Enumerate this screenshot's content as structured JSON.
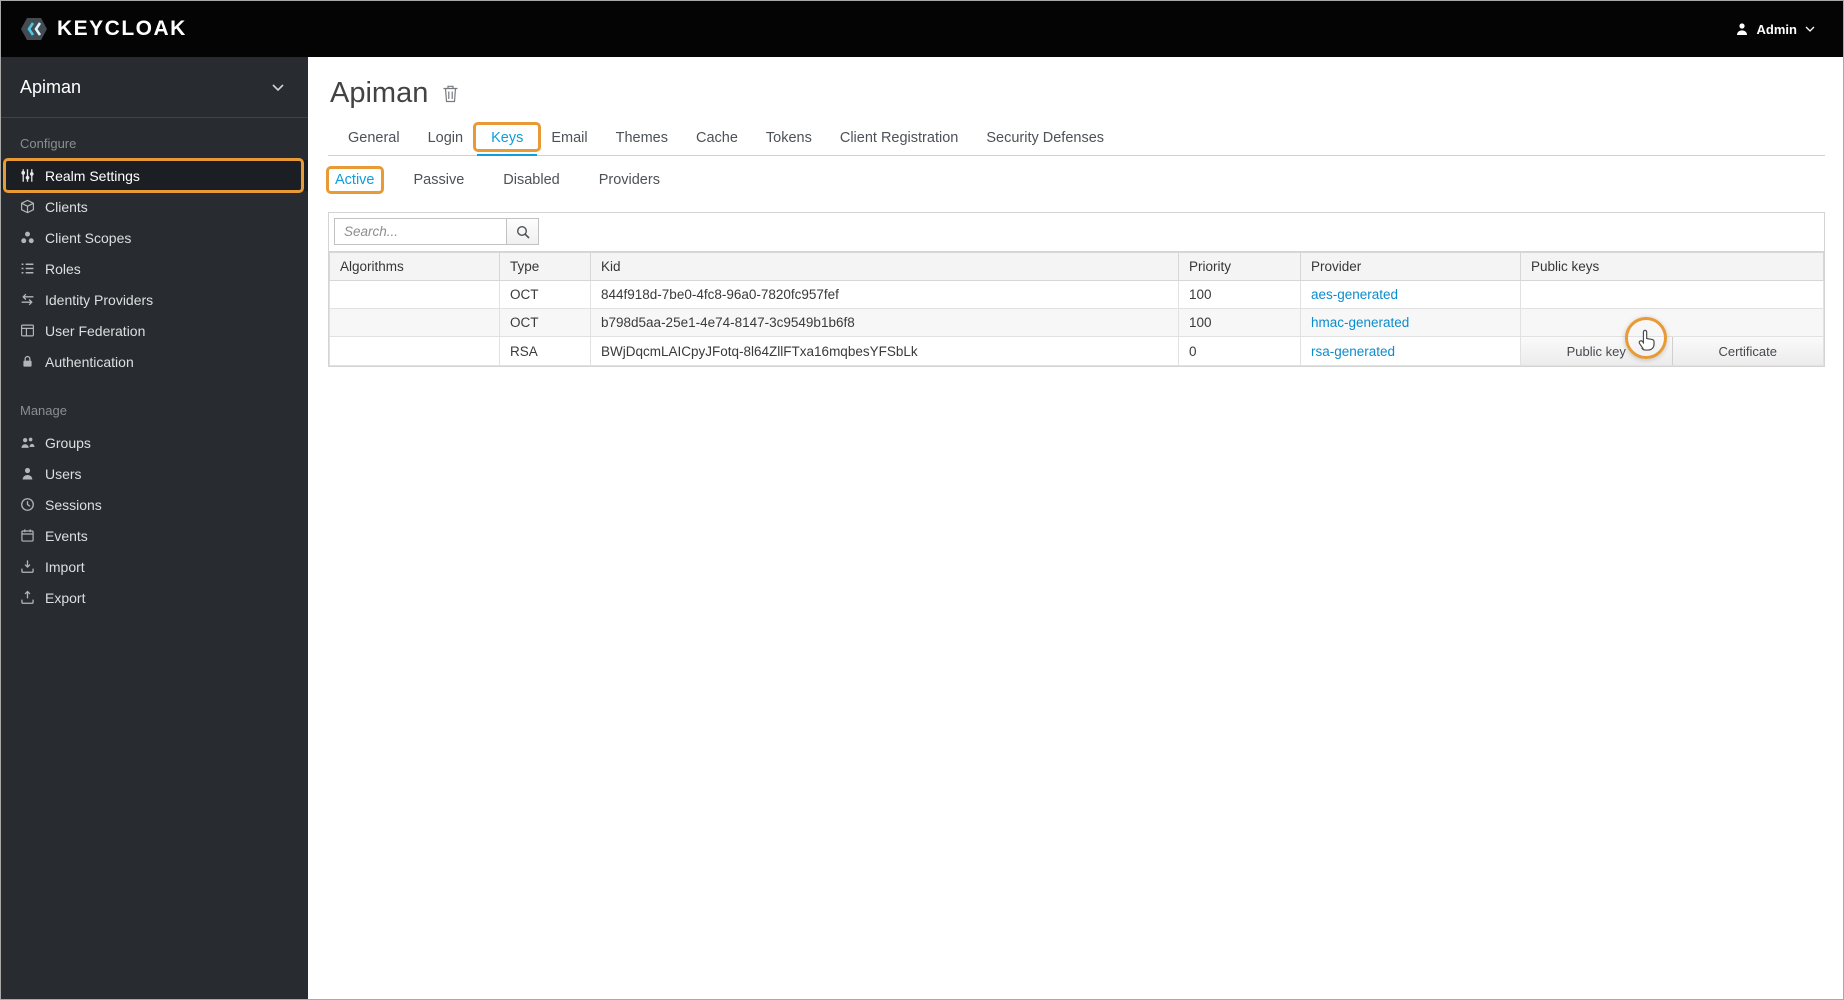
{
  "topbar": {
    "brand": "KEYCLOAK",
    "user": "Admin"
  },
  "sidebar": {
    "realm": "Apiman",
    "sections": [
      {
        "label": "Configure",
        "items": [
          {
            "label": "Realm Settings",
            "icon": "sliders-icon",
            "active": true,
            "highlighted": true
          },
          {
            "label": "Clients",
            "icon": "cube-icon"
          },
          {
            "label": "Client Scopes",
            "icon": "circles-cluster-icon"
          },
          {
            "label": "Roles",
            "icon": "list-icon"
          },
          {
            "label": "Identity Providers",
            "icon": "exchange-arrows-icon"
          },
          {
            "label": "User Federation",
            "icon": "table-grid-icon"
          },
          {
            "label": "Authentication",
            "icon": "lock-icon"
          }
        ]
      },
      {
        "label": "Manage",
        "items": [
          {
            "label": "Groups",
            "icon": "groups-icon"
          },
          {
            "label": "Users",
            "icon": "user-icon"
          },
          {
            "label": "Sessions",
            "icon": "clock-icon"
          },
          {
            "label": "Events",
            "icon": "calendar-icon"
          },
          {
            "label": "Import",
            "icon": "import-icon"
          },
          {
            "label": "Export",
            "icon": "export-icon"
          }
        ]
      }
    ]
  },
  "main": {
    "title": "Apiman",
    "title_action_icon": "trash-icon",
    "tabs": [
      {
        "label": "General"
      },
      {
        "label": "Login"
      },
      {
        "label": "Keys",
        "active": true,
        "highlighted": true
      },
      {
        "label": "Email"
      },
      {
        "label": "Themes"
      },
      {
        "label": "Cache"
      },
      {
        "label": "Tokens"
      },
      {
        "label": "Client Registration"
      },
      {
        "label": "Security Defenses"
      }
    ],
    "subtabs": [
      {
        "label": "Active",
        "active": true,
        "highlighted": true
      },
      {
        "label": "Passive"
      },
      {
        "label": "Disabled"
      },
      {
        "label": "Providers"
      }
    ],
    "search": {
      "placeholder": "Search...",
      "button_icon": "search-icon"
    },
    "table": {
      "columns": [
        "Algorithms",
        "Type",
        "Kid",
        "Priority",
        "Provider",
        "Public keys"
      ],
      "rows": [
        {
          "algorithms": "",
          "type": "OCT",
          "kid": "844f918d-7be0-4fc8-96a0-7820fc957fef",
          "priority": "100",
          "provider": "aes-generated",
          "public_keys": []
        },
        {
          "algorithms": "",
          "type": "OCT",
          "kid": "b798d5aa-25e1-4e74-8147-3c9549b1b6f8",
          "priority": "100",
          "provider": "hmac-generated",
          "public_keys": []
        },
        {
          "algorithms": "",
          "type": "RSA",
          "kid": "BWjDqcmLAICpyJFotq-8l64ZllFTxa16mqbesYFSbLk",
          "priority": "0",
          "provider": "rsa-generated",
          "public_keys": [
            "Public key",
            "Certificate"
          ]
        }
      ]
    }
  },
  "annotations": {
    "color": "#e79a35",
    "highlighted_elements": [
      "Realm Settings sidebar item",
      "Keys tab",
      "Active subtab",
      "cursor circle over Public key button"
    ]
  },
  "colors": {
    "accent": "#0c9fdc",
    "topbar_bg": "#040404",
    "sidebar_bg": "#282c31",
    "annotation": "#e79a35"
  }
}
